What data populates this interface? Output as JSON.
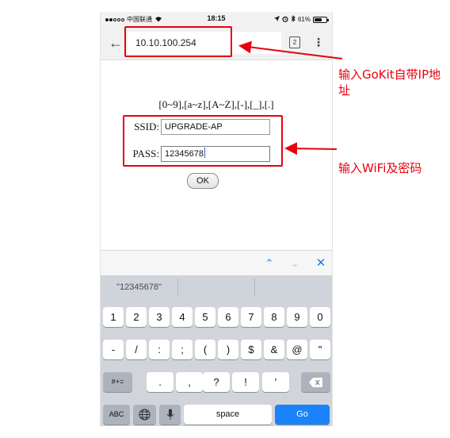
{
  "status_bar": {
    "carrier": "中国联通",
    "time": "18:15",
    "battery": "61%",
    "battery_level": 0.61
  },
  "browser": {
    "url": "10.10.100.254",
    "tab_count": "2",
    "back_icon": "arrow-left-icon",
    "menu_icon": "more-vertical-icon"
  },
  "page": {
    "format_hint": "[0~9],[a~z],[A~Z],[-],[_],[.]",
    "ssid_label": "SSID:",
    "ssid_value": "UPGRADE-AP",
    "pass_label": "PASS:",
    "pass_value": "12345678",
    "ok_label": "OK"
  },
  "suggestions": [
    "\"12345678\"",
    "",
    ""
  ],
  "keyboard": {
    "row1": [
      "1",
      "2",
      "3",
      "4",
      "5",
      "6",
      "7",
      "8",
      "9",
      "0"
    ],
    "row2": [
      "-",
      "/",
      ":",
      ";",
      "(",
      ")",
      "$",
      "&",
      "@",
      "\""
    ],
    "row3_mode": "#+=",
    "row3": [
      ".",
      ",",
      "?",
      "!",
      "'"
    ],
    "abc_label": "ABC",
    "space_label": "space",
    "go_label": "Go"
  },
  "annotations": {
    "ip_note": "输入GoKit自带IP地址",
    "wifi_note": "输入WiFi及密码",
    "color": "#e8000e"
  }
}
